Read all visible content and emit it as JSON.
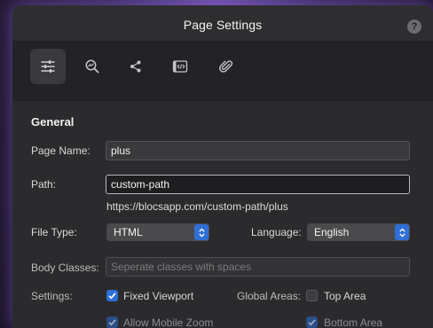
{
  "window": {
    "title": "Page Settings",
    "help_icon": "question-circle-icon",
    "help_text": "?"
  },
  "toolbar": {
    "tabs": [
      {
        "name": "general",
        "icon": "sliders-icon",
        "active": true
      },
      {
        "name": "seo",
        "icon": "search-analytics-icon",
        "active": false
      },
      {
        "name": "social",
        "icon": "share-icon",
        "active": false
      },
      {
        "name": "code",
        "icon": "code-icon",
        "active": false
      },
      {
        "name": "attachments",
        "icon": "paperclip-icon",
        "active": false
      }
    ]
  },
  "general": {
    "section_title": "General",
    "page_name": {
      "label": "Page Name:",
      "value": "plus"
    },
    "path": {
      "label": "Path:",
      "value": "custom-path",
      "url_preview": "https://blocsapp.com/custom-path/plus"
    },
    "file_type": {
      "label": "File Type:",
      "value": "HTML"
    },
    "language": {
      "label": "Language:",
      "value": "English"
    },
    "body_classes": {
      "label": "Body Classes:",
      "value": "",
      "placeholder": "Seperate classes with spaces"
    },
    "settings": {
      "label": "Settings:",
      "fixed_viewport": {
        "label": "Fixed Viewport",
        "checked": true
      },
      "allow_mobile_zoom": {
        "label": "Allow Mobile Zoom",
        "checked": true,
        "disabled": true
      }
    },
    "global_areas": {
      "label": "Global Areas:",
      "top_area": {
        "label": "Top Area",
        "checked": false
      },
      "bottom_area": {
        "label": "Bottom Area",
        "checked": true,
        "disabled": true
      }
    }
  },
  "colors": {
    "accent": "#2d6fd7",
    "panel_bg": "#2b2b2d",
    "toolbar_bg": "#232325",
    "glow": "#8c64dc"
  }
}
